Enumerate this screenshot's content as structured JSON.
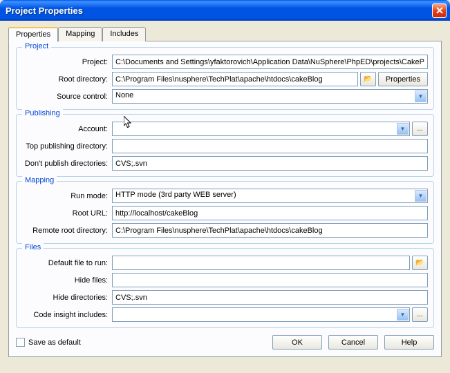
{
  "window": {
    "title": "Project Properties"
  },
  "tabs": {
    "properties": "Properties",
    "mapping": "Mapping",
    "includes": "Includes"
  },
  "groups": {
    "project": {
      "legend": "Project",
      "project_label": "Project:",
      "project_value": "C:\\Documents and Settings\\yfaktorovich\\Application Data\\NuSphere\\PhpED\\projects\\CakePh",
      "rootdir_label": "Root directory:",
      "rootdir_value": "C:\\Program Files\\nusphere\\TechPlat\\apache\\htdocs\\cakeBlog",
      "rootdir_props_btn": "Properties",
      "srcctrl_label": "Source control:",
      "srcctrl_value": "None"
    },
    "publishing": {
      "legend": "Publishing",
      "account_label": "Account:",
      "account_value": "",
      "topdir_label": "Top publishing directory:",
      "topdir_value": "",
      "dontpub_label": "Don't publish directories:",
      "dontpub_value": "CVS;.svn"
    },
    "mapping": {
      "legend": "Mapping",
      "runmode_label": "Run mode:",
      "runmode_value": "HTTP mode (3rd party WEB server)",
      "rooturl_label": "Root URL:",
      "rooturl_value": "http://localhost/cakeBlog",
      "remotedir_label": "Remote root directory:",
      "remotedir_value": "C:\\Program Files\\nusphere\\TechPlat\\apache\\htdocs\\cakeBlog"
    },
    "files": {
      "legend": "Files",
      "default_label": "Default file to run:",
      "default_value": "",
      "hidef_label": "Hide files:",
      "hidef_value": "",
      "hided_label": "Hide directories:",
      "hided_value": "CVS;.svn",
      "codeins_label": "Code insight includes:",
      "codeins_value": ""
    }
  },
  "footer": {
    "save_default": "Save as default",
    "ok": "OK",
    "cancel": "Cancel",
    "help": "Help"
  },
  "icons": {
    "ellipsis": "...",
    "folder": "📂"
  }
}
